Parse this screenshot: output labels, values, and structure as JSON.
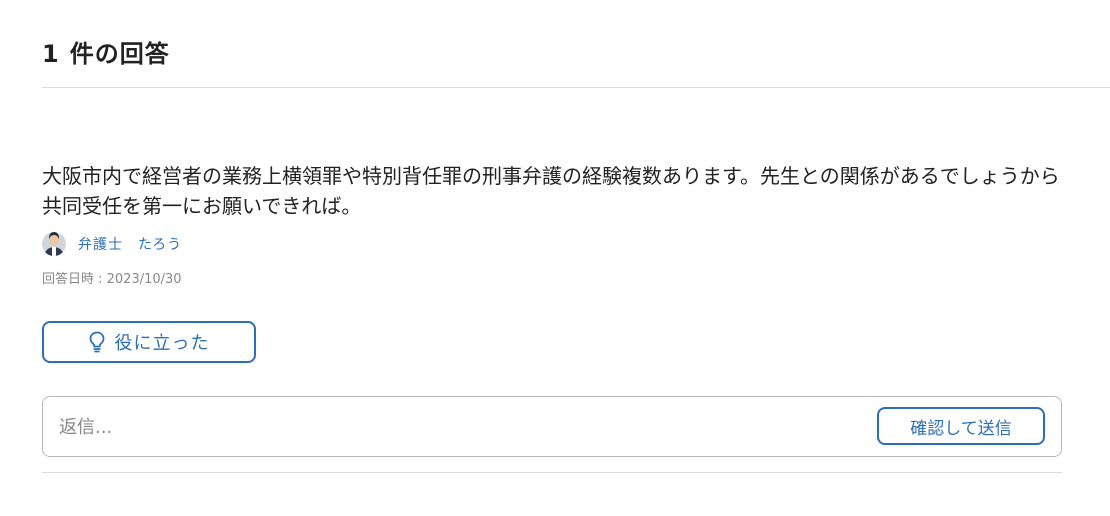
{
  "header": {
    "count": "1",
    "title": "件の回答"
  },
  "answer": {
    "body": "大阪市内で経営者の業務上横領罪や特別背任罪の刑事弁護の経験複数あります。先生との関係があるでしょうから共同受任を第一にお願いできれば。",
    "author": {
      "name": "弁護士　たろう",
      "avatar_icon": "lawyer-avatar"
    },
    "date": "回答日時 : 2023/10/30"
  },
  "helpful_button": {
    "icon": "lightbulb-icon",
    "label": "役に立った"
  },
  "reply": {
    "placeholder": "返信...",
    "value": "",
    "send_label": "確認して送信"
  },
  "colors": {
    "accent": "#2b6fb6",
    "text": "#222222",
    "muted": "#888888",
    "border": "#b8b8b8",
    "divider": "#dcdcdc"
  }
}
